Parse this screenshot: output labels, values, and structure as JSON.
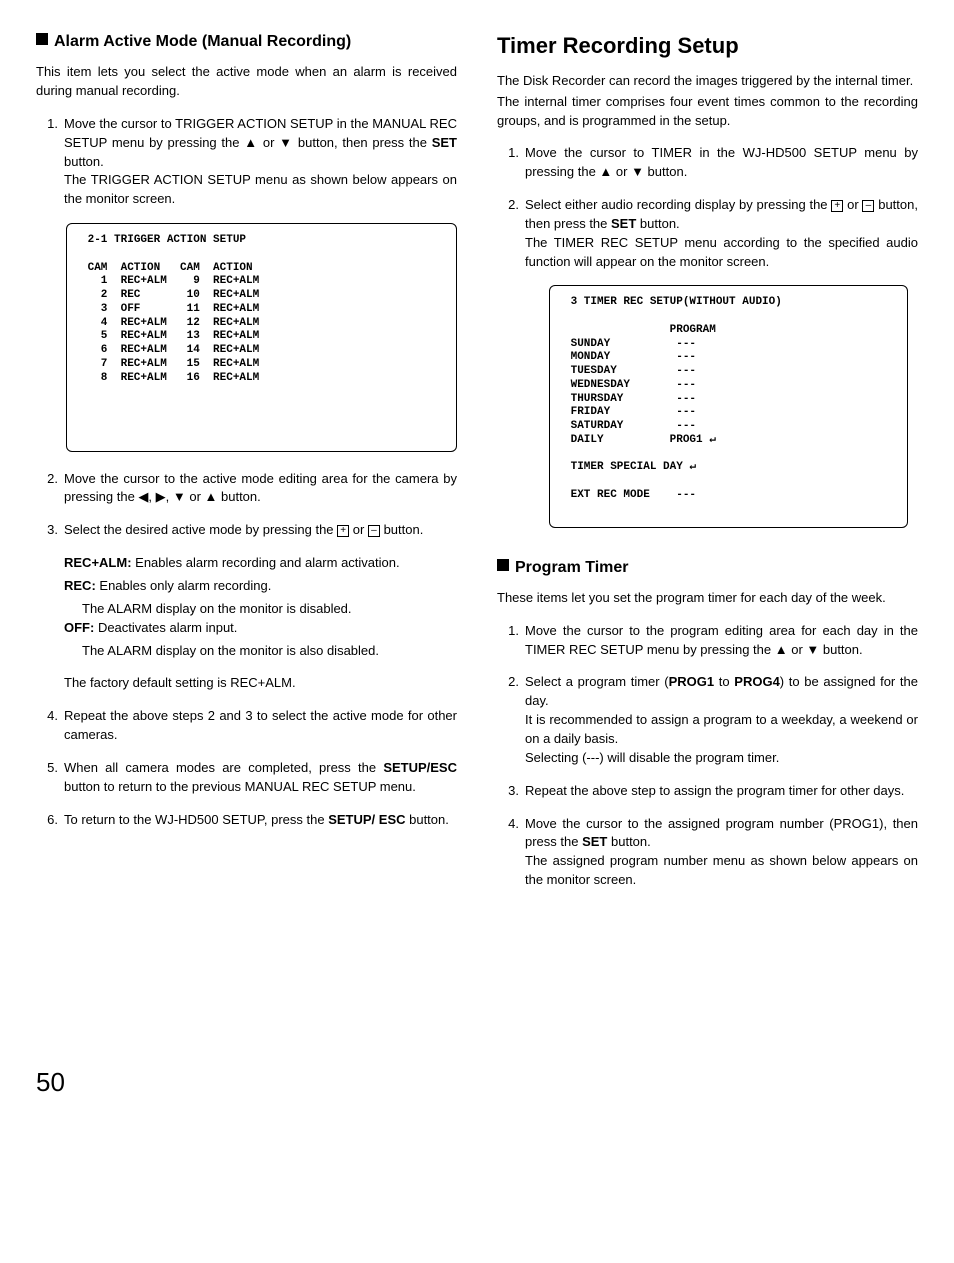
{
  "left": {
    "heading": "Alarm Active Mode (Manual Recording)",
    "intro": "This item lets you select the active mode when an alarm is received during manual recording.",
    "steps": [
      "Move the cursor to TRIGGER ACTION SETUP in the MANUAL REC SETUP menu by pressing the ▲ or ▼ button, then press the SET button.\nThe TRIGGER ACTION SETUP menu as shown below appears on the monitor screen.",
      "Move the cursor to the active mode editing area for the camera by pressing the ◀, ▶, ▼ or ▲ button.",
      "Select the desired active mode by pressing the ⊞ or ⊟ button.",
      "Repeat the above steps 2 and 3 to select the active mode for other cameras.",
      "When all camera modes are completed, press the SETUP/ESC button to return to the previous MANUAL REC SETUP menu.",
      "To return to the WJ-HD500 SETUP, press the SETUP/ESC button."
    ],
    "screen": {
      "title": "2-1 TRIGGER ACTION SETUP",
      "col1_header": "CAM  ACTION",
      "col2_header": "CAM  ACTION",
      "rows": [
        [
          "1",
          "REC+ALM",
          "9",
          "REC+ALM"
        ],
        [
          "2",
          "REC",
          "10",
          "REC+ALM"
        ],
        [
          "3",
          "OFF",
          "11",
          "REC+ALM"
        ],
        [
          "4",
          "REC+ALM",
          "12",
          "REC+ALM"
        ],
        [
          "5",
          "REC+ALM",
          "13",
          "REC+ALM"
        ],
        [
          "6",
          "REC+ALM",
          "14",
          "REC+ALM"
        ],
        [
          "7",
          "REC+ALM",
          "15",
          "REC+ALM"
        ],
        [
          "8",
          "REC+ALM",
          "16",
          "REC+ALM"
        ]
      ]
    },
    "defs": {
      "rec_alm_label": "REC+ALM:",
      "rec_alm_text": " Enables alarm recording and alarm activation.",
      "rec_label": "REC:",
      "rec_text": " Enables only alarm recording.",
      "rec_sub": "The ALARM display on the monitor is disabled.",
      "off_label": "OFF:",
      "off_text": " Deactivates alarm input.",
      "off_sub": "The ALARM display on the monitor is also disabled.",
      "note": "The factory default setting is REC+ALM."
    }
  },
  "right": {
    "heading": "Timer Recording Setup",
    "intro1": "The Disk Recorder can record the images triggered by the internal timer.",
    "intro2": "The internal timer comprises four event times common to the recording groups, and is programmed in the setup.",
    "steps": [
      "Move the cursor to TIMER in the WJ-HD500 SETUP menu by pressing the ▲ or ▼ button.",
      "Select either audio recording display by pressing the ⊞ or ⊟ button, then press the SET button.\nThe TIMER REC SETUP menu according to the specified audio function will appear on the monitor screen."
    ],
    "screen": {
      "title": "3 TIMER REC SETUP(WITHOUT AUDIO)",
      "program_header": "PROGRAM",
      "days": [
        [
          "SUNDAY",
          "---"
        ],
        [
          "MONDAY",
          "---"
        ],
        [
          "TUESDAY",
          "---"
        ],
        [
          "WEDNESDAY",
          "---"
        ],
        [
          "THURSDAY",
          "---"
        ],
        [
          "FRIDAY",
          "---"
        ],
        [
          "SATURDAY",
          "---"
        ],
        [
          "DAILY",
          "PROG1 ↲"
        ]
      ],
      "special": "TIMER SPECIAL DAY ↲",
      "ext": "EXT REC MODE   ---"
    },
    "program_timer": {
      "heading": "Program Timer",
      "intro": "These items let you set the program timer for each day of the week.",
      "steps": [
        "Move the cursor to the program editing area for each day in the TIMER REC SETUP menu by pressing the ▲ or ▼ button.",
        "Select a program timer (PROG1 to PROG4) to be assigned for the day.\nIt is recommended to assign a program to a weekday, a weekend or on a daily basis.\nSelecting (---) will disable the program timer.",
        "Repeat the above step to assign the program timer for other days.",
        "Move the cursor to the assigned program number (PROG1), then press the SET button.\nThe assigned program number menu as shown below appears on the monitor screen."
      ]
    }
  },
  "page_number": "50"
}
